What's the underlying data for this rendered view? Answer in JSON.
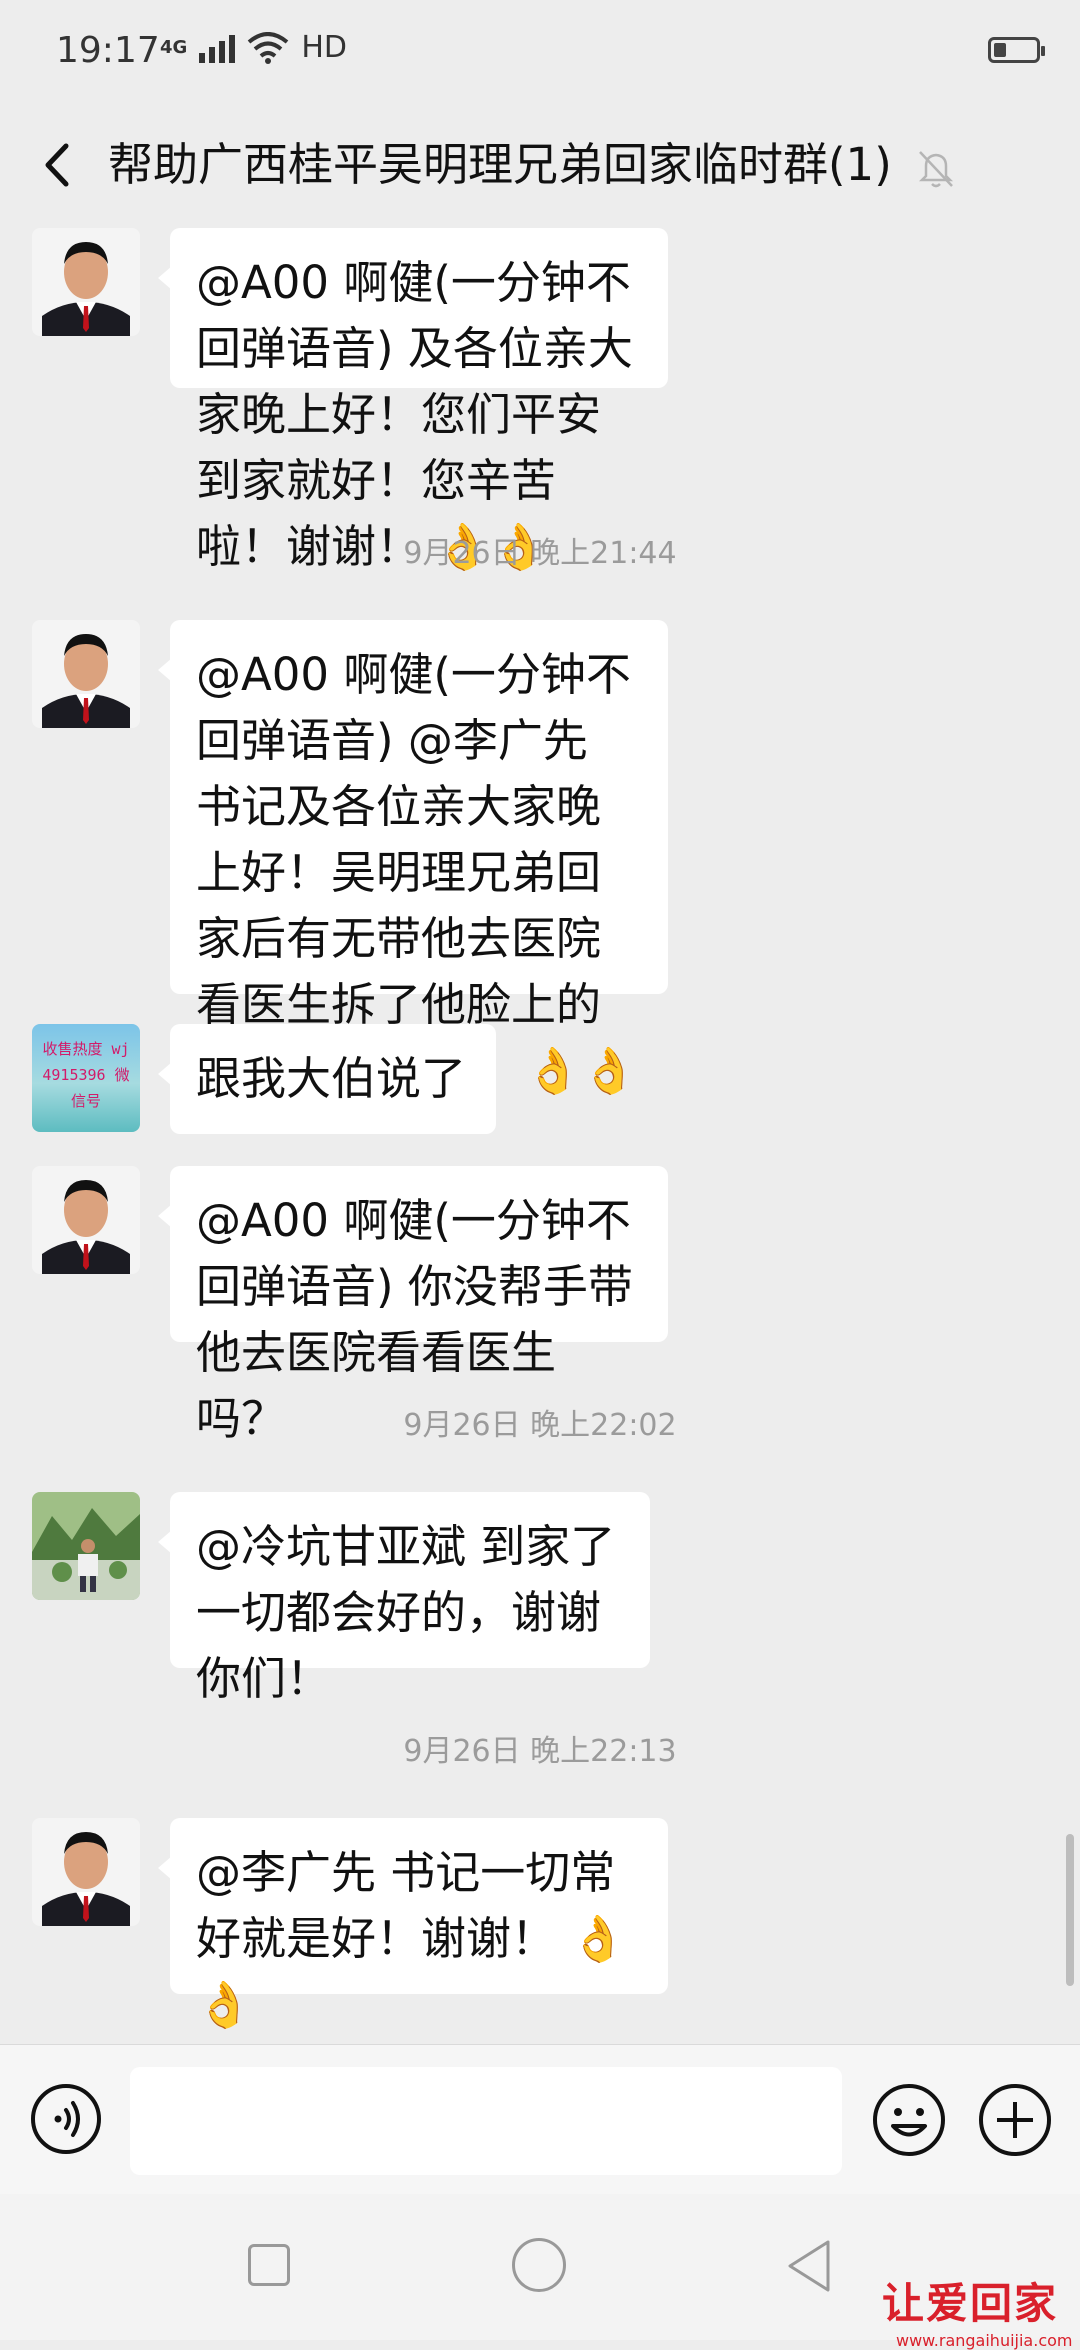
{
  "status_bar": {
    "time": "19:17",
    "network": "4G",
    "hd": "HD",
    "battery_level": 0.3
  },
  "header": {
    "back_icon": "chevron-left-icon",
    "title": "帮助广西桂平吴明理兄弟回家临时群(1)",
    "mute_icon": "bell-off-icon"
  },
  "messages": [
    {
      "sender_avatar": "man-suit-avatar",
      "text": "@A00 啊健(一分钟不回弹语音) 及各位亲大家晚上好！您们平安到家就好！您辛苦啦！谢谢！ 👌👌"
    },
    {
      "timestamp": "9月26日 晚上21:44"
    },
    {
      "sender_avatar": "man-suit-avatar",
      "text": "@A00 啊健(一分钟不回弹语音) @李广先  书记及各位亲大家晚上好！吴明理兄弟回家后有无带他去医院看医生拆了他脸上的针线呢？谢谢！ 👌👌"
    },
    {
      "sender_avatar": "ad-avatar",
      "avatar_text": "收售热度 wj4915396 微信号",
      "text": "跟我大伯说了"
    },
    {
      "sender_avatar": "man-suit-avatar",
      "text": "@A00 啊健(一分钟不回弹语音) 你没帮手带他去医院看看医生吗？"
    },
    {
      "timestamp": "9月26日 晚上22:02"
    },
    {
      "sender_avatar": "landscape-avatar",
      "text": "@冷坑甘亚斌  到家了一切都会好的，谢谢你们！"
    },
    {
      "timestamp": "9月26日 晚上22:13"
    },
    {
      "sender_avatar": "man-suit-avatar",
      "text": "@李广先  书记一切常好就是好！谢谢！ 👌👌"
    }
  ],
  "input_bar": {
    "voice_icon": "voice-input-icon",
    "input_value": "",
    "emoji_icon": "emoji-icon",
    "plus_icon": "plus-icon"
  },
  "watermark": {
    "logo": "让爱回家",
    "url": "www.rangaihuijia.com"
  }
}
